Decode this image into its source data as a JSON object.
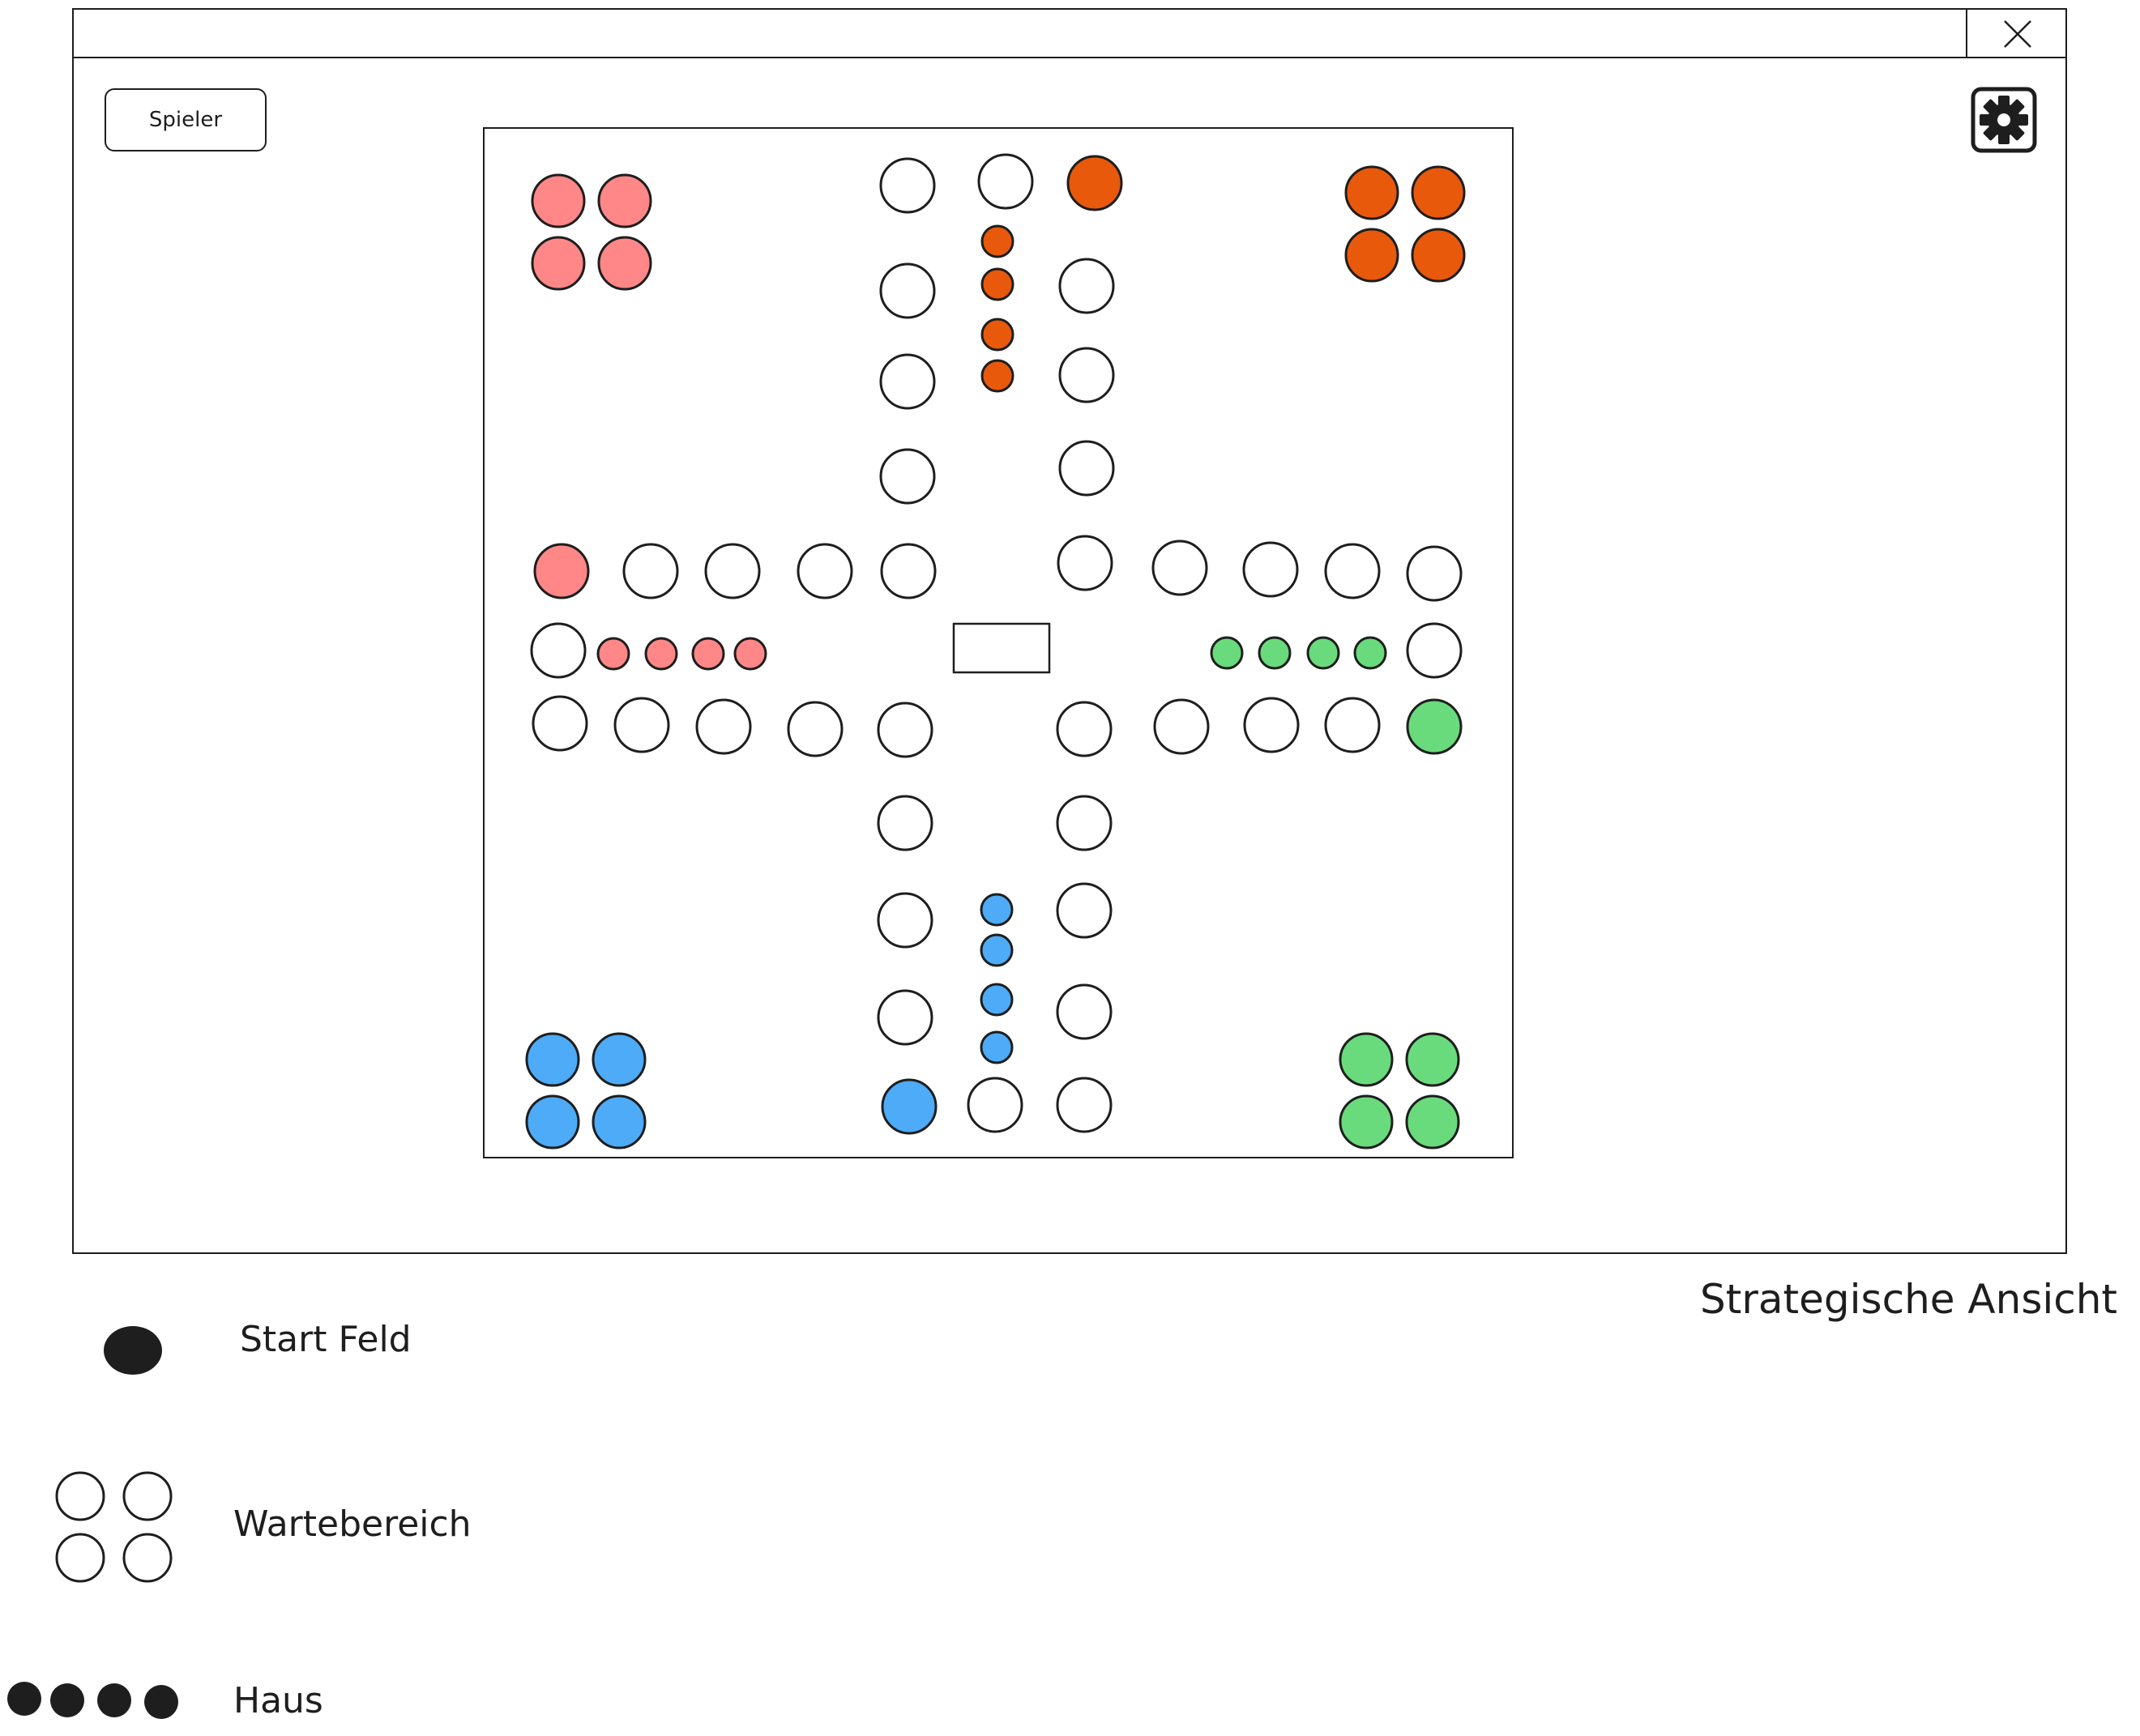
{
  "window": {
    "close_icon": "close-icon",
    "player_button_label": "Spieler",
    "settings_icon": "gear-icon"
  },
  "board": {
    "colors": {
      "red": "#ff8787",
      "orange": "#e8590c",
      "green": "#69db7c",
      "blue": "#4dabf7",
      "empty": "#ffffff",
      "stroke": "#1e1e1e"
    }
  },
  "view_title": "Strategische Ansicht",
  "legend": {
    "start_label": "Start Feld",
    "waiting_label": "Wartebereich",
    "house_label": "Haus"
  }
}
